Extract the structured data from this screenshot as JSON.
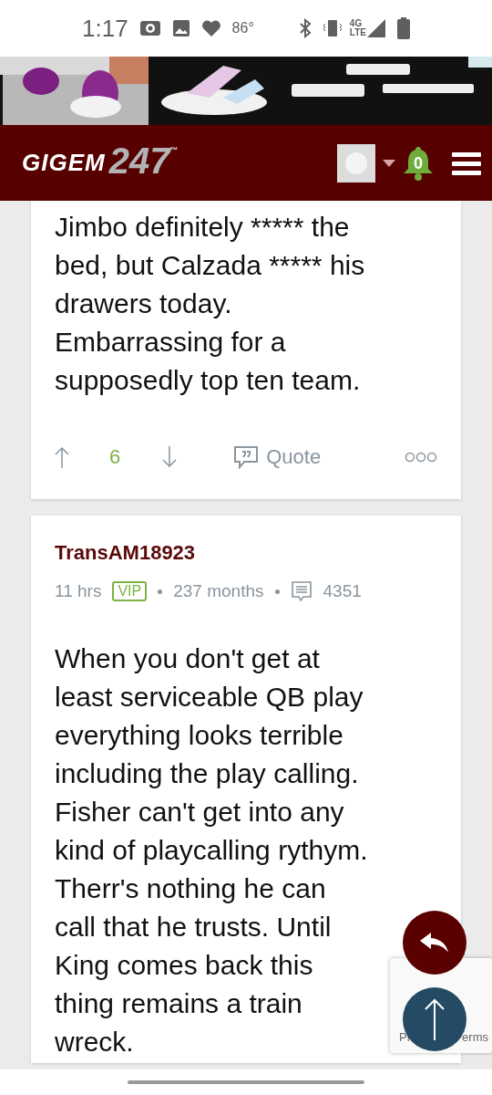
{
  "status_bar": {
    "time": "1:17",
    "temperature": "86°",
    "network": "4G\nLTE"
  },
  "header": {
    "logo_word": "GIGEM",
    "logo_number": "247",
    "logo_mark": "™",
    "notifications": "0"
  },
  "posts": [
    {
      "body": "Jimbo definitely ***** the\nbed, but Calzada ***** his\ndrawers today.\nEmbarrassing for a\nsupposedly top ten team.",
      "votes": "6",
      "quote": "Quote"
    },
    {
      "author": "TransAM18923",
      "age": "11 hrs",
      "badge": "VIP",
      "tenure": "237 months",
      "post_count": "4351",
      "body": "When you don't get at\nleast serviceable QB play\neverything looks terrible\nincluding the play calling.\nFisher can't get into any\nkind of playcalling rythym.\nTherr's nothing he can\ncall that he trusts. Until\nKing comes back this\nthing remains a train\nwreck."
    }
  ],
  "recaptcha": {
    "text_left": "Pr",
    "text_right": "erms"
  }
}
